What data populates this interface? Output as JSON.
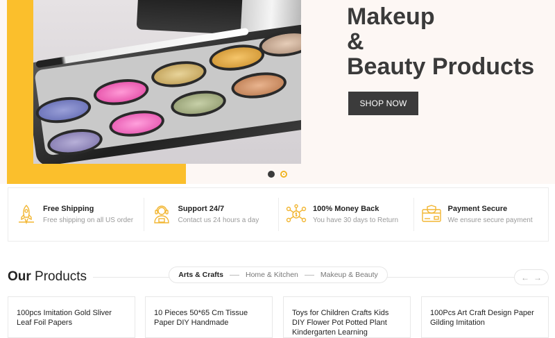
{
  "hero": {
    "title_line1": "Makeup",
    "title_line2": "&",
    "title_line3": "Beauty Products",
    "shop_button": "SHOP NOW",
    "accent_color": "#fbbf2c",
    "slider_dots": 2,
    "active_dot": 1
  },
  "features": [
    {
      "icon": "rocket-icon",
      "title": "Free Shipping",
      "subtitle": "Free shipping on all US order"
    },
    {
      "icon": "support-agent-icon",
      "title": "Support 24/7",
      "subtitle": "Contact us 24 hours a day"
    },
    {
      "icon": "money-back-icon",
      "title": "100% Money Back",
      "subtitle": "You have 30 days to Return"
    },
    {
      "icon": "secure-payment-icon",
      "title": "Payment Secure",
      "subtitle": "We ensure secure payment"
    }
  ],
  "products": {
    "title_bold": "Our",
    "title_rest": " Products",
    "tabs": [
      "Arts & Crafts",
      "Home & Kitchen",
      "Makeup & Beauty"
    ],
    "active_tab": 0,
    "prev_arrow": "←",
    "next_arrow": "→",
    "items": [
      {
        "name": "100pcs Imitation Gold Sliver Leaf Foil Papers"
      },
      {
        "name": "10 Pieces 50*65 Cm Tissue Paper DIY Handmade"
      },
      {
        "name": "Toys for Children Crafts Kids DIY Flower Pot Potted Plant Kindergarten Learning Education"
      },
      {
        "name": "100Pcs Art Craft Design Paper Gilding Imitation"
      }
    ]
  }
}
